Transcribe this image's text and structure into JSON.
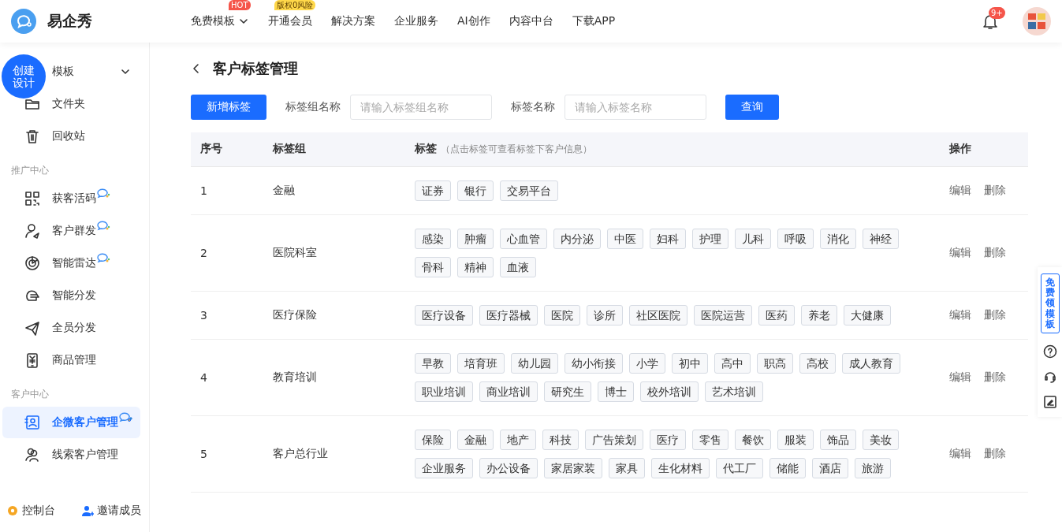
{
  "brand": {
    "name": "易企秀"
  },
  "nav": [
    {
      "label": "免费模板",
      "dropdown": true,
      "badge": {
        "text": "HOT",
        "color": "#f5554a"
      }
    },
    {
      "label": "开通会员",
      "dropdown": false,
      "badge": {
        "text": "版权0风险",
        "color": "#ffd84a"
      }
    },
    {
      "label": "解决方案",
      "dropdown": false
    },
    {
      "label": "企业服务",
      "dropdown": false
    },
    {
      "label": "AI创作",
      "dropdown": false
    },
    {
      "label": "内容中台",
      "dropdown": false
    },
    {
      "label": "下载APP",
      "dropdown": false
    }
  ],
  "notifications": {
    "badge": "9+"
  },
  "create_button": "创建设计",
  "sidebar": {
    "sections": [
      {
        "items": [
          {
            "label": "模板",
            "expandable": true,
            "wecom": false,
            "selected": false
          },
          {
            "label": "文件夹",
            "expandable": false,
            "wecom": false,
            "selected": false
          },
          {
            "label": "回收站",
            "expandable": false,
            "wecom": false,
            "selected": false
          }
        ]
      },
      {
        "title": "推广中心",
        "items": [
          {
            "label": "获客活码",
            "expandable": false,
            "wecom": true,
            "selected": false
          },
          {
            "label": "客户群发",
            "expandable": false,
            "wecom": true,
            "selected": false
          },
          {
            "label": "智能雷达",
            "expandable": false,
            "wecom": true,
            "selected": false
          },
          {
            "label": "智能分发",
            "expandable": false,
            "wecom": false,
            "selected": false
          },
          {
            "label": "全员分发",
            "expandable": false,
            "wecom": false,
            "selected": false
          },
          {
            "label": "商品管理",
            "expandable": false,
            "wecom": false,
            "selected": false
          }
        ]
      },
      {
        "title": "客户中心",
        "items": [
          {
            "label": "企微客户管理",
            "expandable": false,
            "wecom": true,
            "selected": true
          },
          {
            "label": "线索客户管理",
            "expandable": false,
            "wecom": false,
            "selected": false
          }
        ]
      }
    ],
    "footer": [
      "控制台",
      "邀请成员"
    ]
  },
  "page": {
    "title": "客户标签管理",
    "add_button": "新增标签",
    "filters": [
      {
        "label": "标签组名称",
        "placeholder": "请输入标签组名称"
      },
      {
        "label": "标签名称",
        "placeholder": "请输入标签名称"
      }
    ],
    "query_button": "查询"
  },
  "table": {
    "columns": [
      {
        "label": "序号"
      },
      {
        "label": "标签组"
      },
      {
        "label": "标签",
        "hint": "（点击标签可查看标签下客户信息）"
      },
      {
        "label": "操作"
      }
    ],
    "rows": [
      {
        "index": "1",
        "group": "金融",
        "tags": [
          "证券",
          "银行",
          "交易平台"
        ],
        "actions": [
          "编辑",
          "删除"
        ]
      },
      {
        "index": "2",
        "group": "医院科室",
        "tags": [
          "感染",
          "肿瘤",
          "心血管",
          "内分泌",
          "中医",
          "妇科",
          "护理",
          "儿科",
          "呼吸",
          "消化",
          "神经",
          "骨科",
          "精神",
          "血液"
        ],
        "actions": [
          "编辑",
          "删除"
        ]
      },
      {
        "index": "3",
        "group": "医疗保险",
        "tags": [
          "医疗设备",
          "医疗器械",
          "医院",
          "诊所",
          "社区医院",
          "医院运营",
          "医药",
          "养老",
          "大健康"
        ],
        "actions": [
          "编辑",
          "删除"
        ]
      },
      {
        "index": "4",
        "group": "教育培训",
        "tags": [
          "早教",
          "培育班",
          "幼儿园",
          "幼小衔接",
          "小学",
          "初中",
          "高中",
          "职高",
          "高校",
          "成人教育",
          "职业培训",
          "商业培训",
          "研究生",
          "博士",
          "校外培训",
          "艺术培训"
        ],
        "actions": [
          "编辑",
          "删除"
        ]
      },
      {
        "index": "5",
        "group": "客户总行业",
        "tags": [
          "保险",
          "金融",
          "地产",
          "科技",
          "广告策划",
          "医疗",
          "零售",
          "餐饮",
          "服装",
          "饰品",
          "美妆",
          "企业服务",
          "办公设备",
          "家居家装",
          "家具",
          "生化材料",
          "代工厂",
          "储能",
          "酒店",
          "旅游"
        ],
        "actions": [
          "编辑",
          "删除"
        ]
      }
    ]
  },
  "float_panel": {
    "promo": "免费领模板"
  }
}
